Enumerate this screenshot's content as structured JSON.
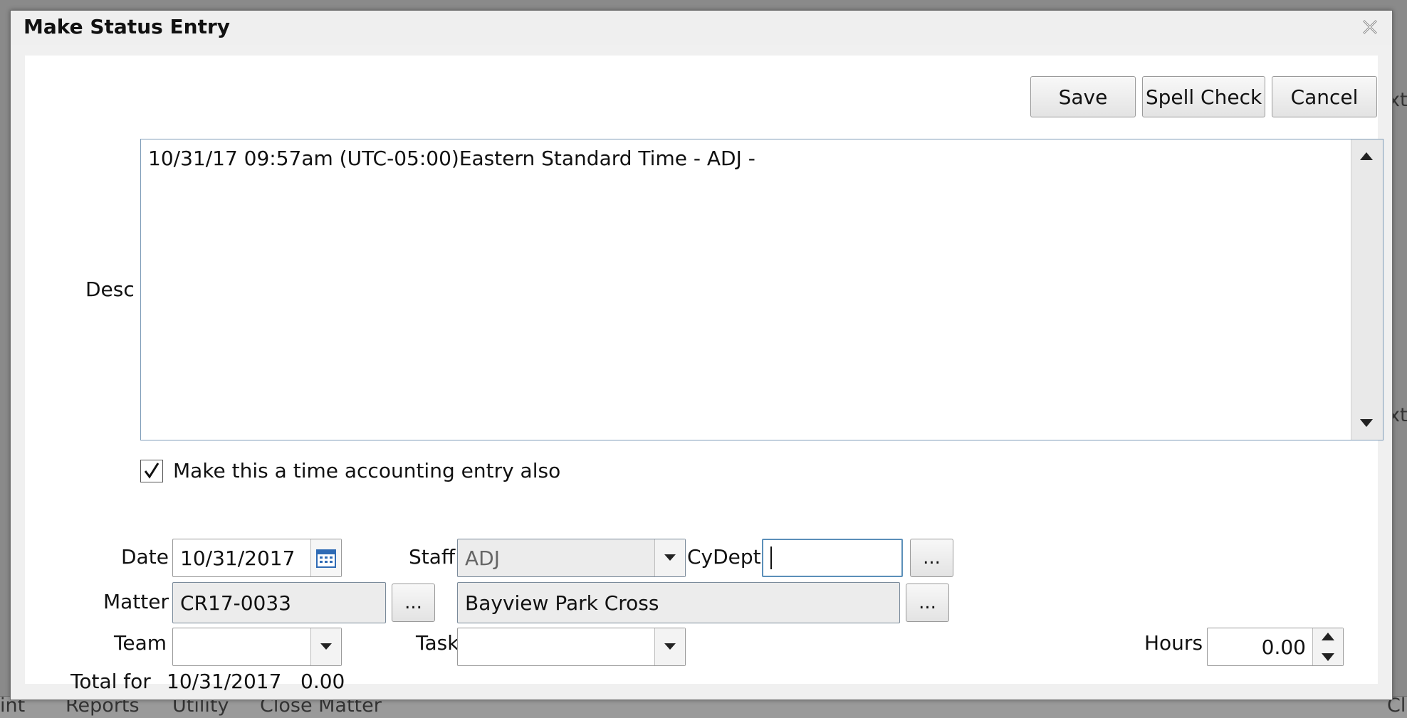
{
  "background": {
    "tabs": [
      "int",
      "Reports",
      "Utility",
      "Close Matter"
    ],
    "edge_right": "xt",
    "edge_right_bottom": "Cl"
  },
  "dialog": {
    "title": "Make Status Entry",
    "close_icon": "close-icon"
  },
  "toolbar": {
    "save_label": "Save",
    "spell_check_label": "Spell Check",
    "cancel_label": "Cancel"
  },
  "desc": {
    "label": "Desc",
    "value": "10/31/17 09:57am (UTC-05:00)Eastern Standard Time - ADJ -"
  },
  "time_entry": {
    "checked": true,
    "label": "Make this a time accounting entry also"
  },
  "form": {
    "date_label": "Date",
    "date_value": "10/31/2017",
    "staff_label": "Staff",
    "staff_value": "ADJ",
    "cydept_label": "CyDept",
    "cydept_value": "",
    "matter_label": "Matter",
    "matter_value": "CR17-0033",
    "matter_name": "Bayview Park Cross",
    "browse_label": "...",
    "team_label": "Team",
    "team_value": "",
    "task_label": "Task",
    "task_value": "",
    "hours_label": "Hours",
    "hours_value": "0.00",
    "total_label": "Total for",
    "total_date": "10/31/2017",
    "total_value": "0.00"
  },
  "colors": {
    "backdrop": "#8a8a8a",
    "dialog_bg": "#f0f0f0",
    "content_bg": "#ffffff",
    "focus_border": "#5b8fb9"
  }
}
